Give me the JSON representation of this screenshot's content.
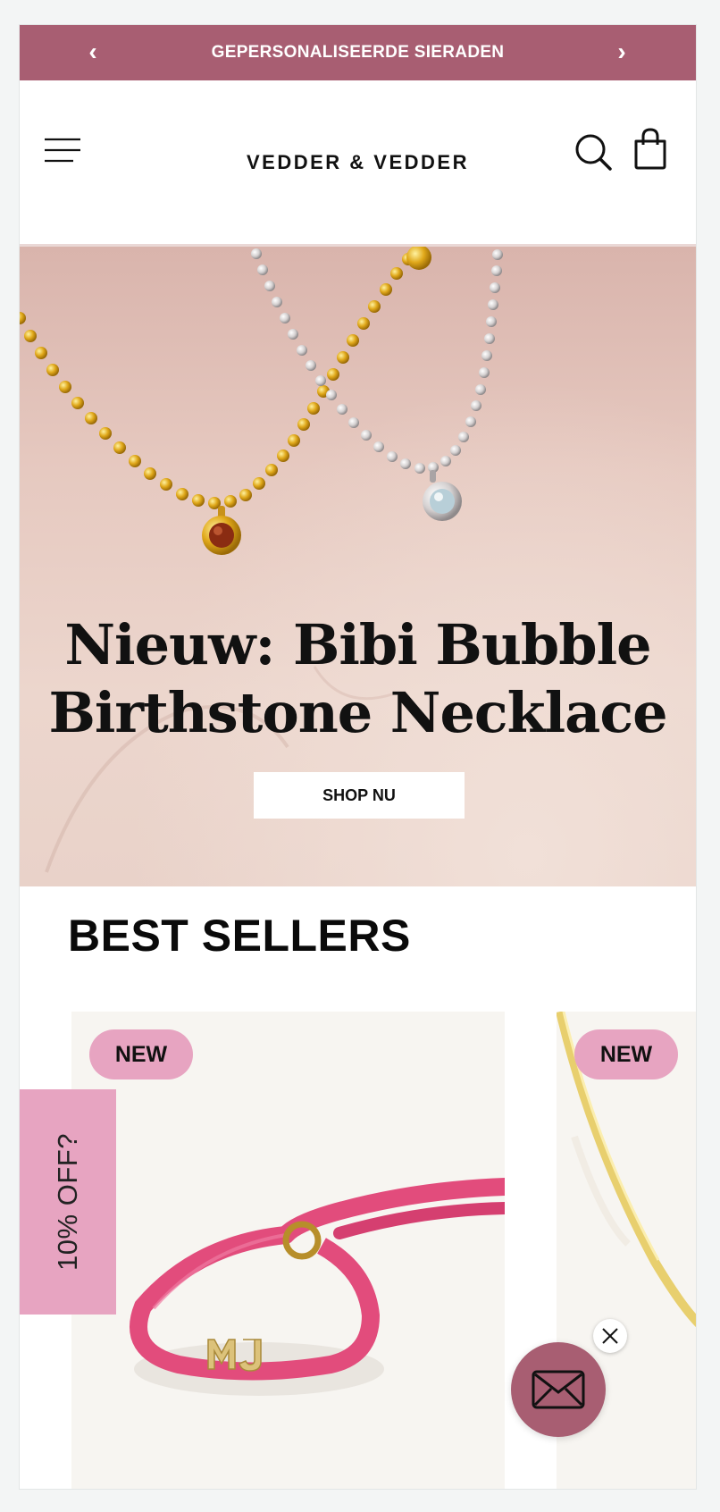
{
  "announcement": {
    "prev_arrow": "‹",
    "text": "GEPERSONALISEERDE SIERADEN",
    "next_arrow": "›",
    "background": "#a85e72"
  },
  "header": {
    "menu_icon": "hamburger-menu-icon",
    "logo": "VEDDER & VEDDER",
    "search_icon": "search-icon",
    "cart_icon": "shopping-bag-icon"
  },
  "hero": {
    "title_line1": "Nieuw: Bibi Bubble",
    "title_line2": "Birthstone Necklace",
    "button_label": "SHOP NU"
  },
  "best_sellers": {
    "title": "BEST SELLERS",
    "products": [
      {
        "badge": "NEW",
        "image": "pink-elastic-bracelet-with-gold-MJ-initials"
      },
      {
        "badge": "NEW",
        "image": "gold-herringbone-chain"
      }
    ],
    "badge_color": "#e7a4c1"
  },
  "discount_tab": {
    "label": "10% OFF?"
  },
  "newsletter": {
    "close_icon": "close-icon",
    "mail_icon": "envelope-icon",
    "color": "#a85e72"
  }
}
